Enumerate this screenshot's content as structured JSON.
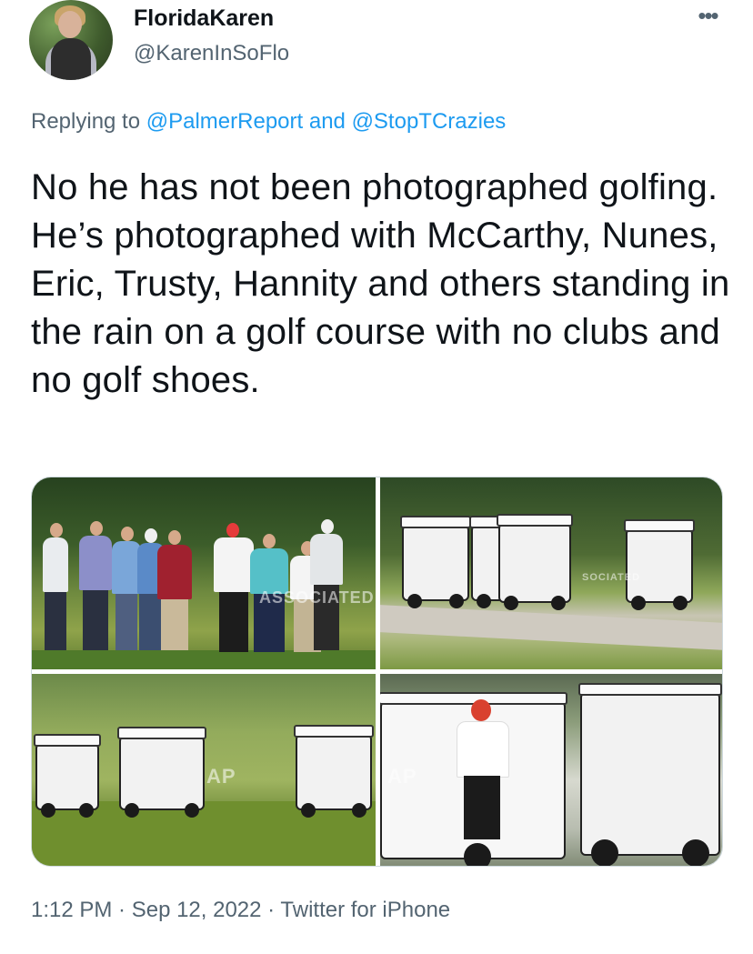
{
  "tweet": {
    "display_name": "FloridaKaren",
    "handle": "@KarenInSoFlo",
    "more_icon": "more-horizontal-icon",
    "reply_prefix": "Replying to",
    "reply_mention_1": "@PalmerReport",
    "reply_and": "and",
    "reply_mention_2": "@StopTCrazies",
    "text": "No he has not been photographed golfing. He’s photographed with McCarthy, Nunes, Eric, Trusty, Hannity and others standing in the rain on a golf course with no clubs and no golf shoes.",
    "timestamp": "1:12 PM · Sep 12, 2022 · Twitter for iPhone"
  },
  "media": {
    "watermark_1": "ASSOCIATED",
    "watermark_2": "AP",
    "watermark_3": "AP",
    "watermark_4": "SOCIATED"
  },
  "colors": {
    "link": "#1d9bf0",
    "secondary_text": "#536471",
    "primary_text": "#0f1419"
  }
}
